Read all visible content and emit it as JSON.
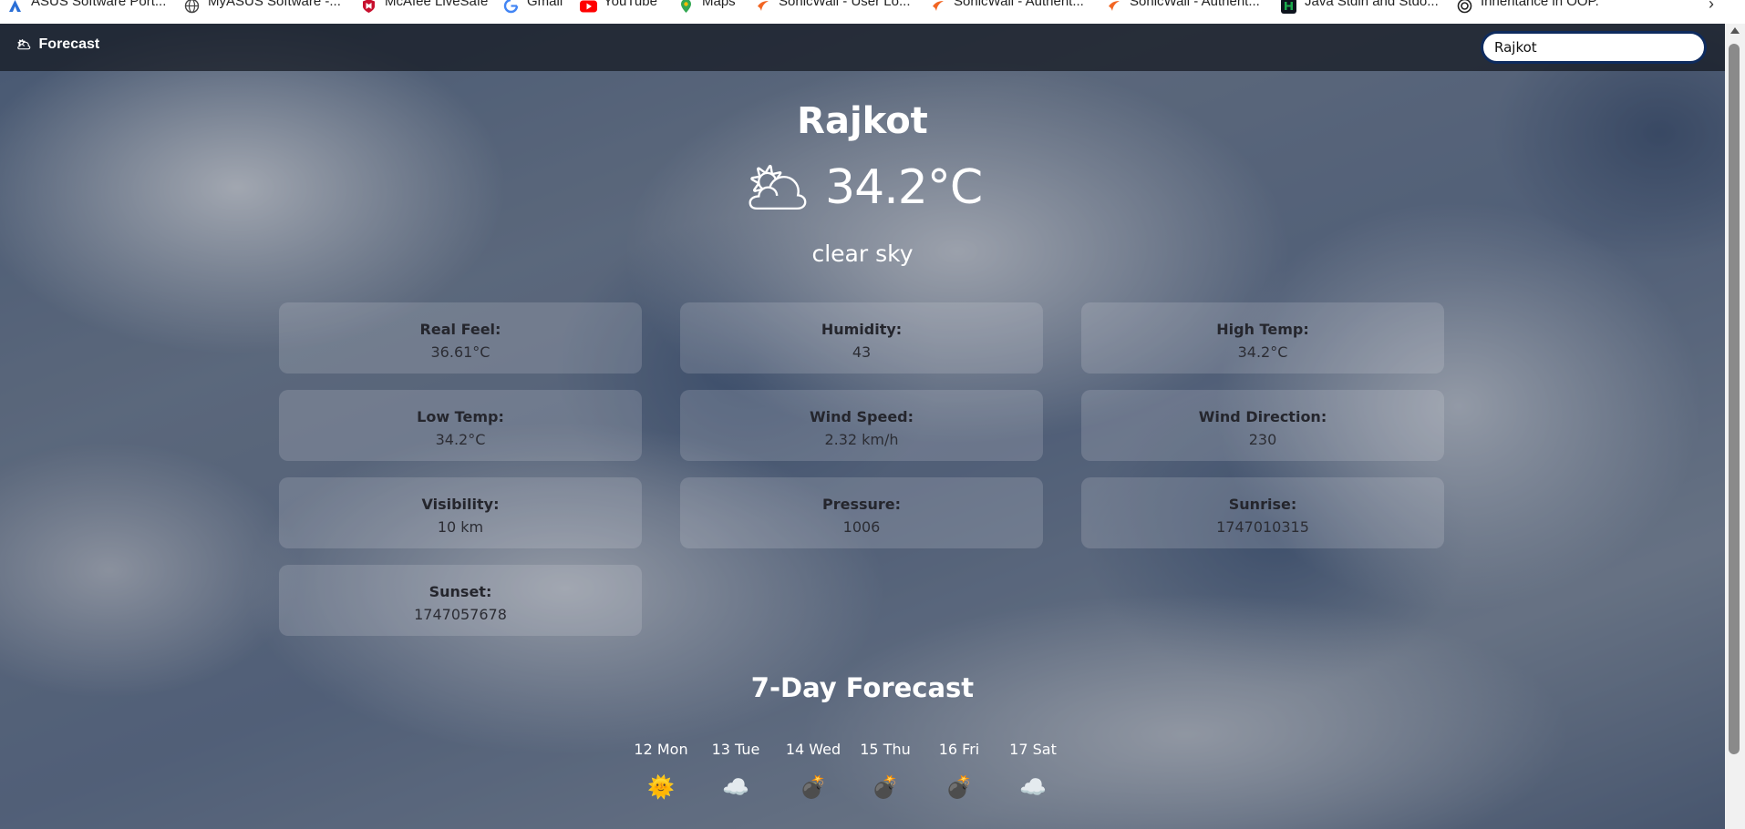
{
  "bookmarks": [
    {
      "label": "ASUS Software Port...",
      "icon": "asus-icon",
      "color": "#2b6fd6"
    },
    {
      "label": "MyASUS Software -...",
      "icon": "globe-icon",
      "color": "#444444"
    },
    {
      "label": "McAfee LiveSafe",
      "icon": "mcafee-shield-icon",
      "color": "#c8102e"
    },
    {
      "label": "Gmail",
      "icon": "google-g-icon",
      "color": "#4285f4"
    },
    {
      "label": "YouTube",
      "icon": "youtube-icon",
      "color": "#ff0000"
    },
    {
      "label": "Maps",
      "icon": "maps-pin-icon",
      "color": "#34a853"
    },
    {
      "label": "SonicWall - User Lo...",
      "icon": "sonicwall-icon",
      "color": "#f26522"
    },
    {
      "label": "SonicWall - Authent...",
      "icon": "sonicwall-icon",
      "color": "#f26522"
    },
    {
      "label": "SonicWall - Authent...",
      "icon": "sonicwall-icon",
      "color": "#f26522"
    },
    {
      "label": "Java Stdin and Stdo...",
      "icon": "hackerrank-icon",
      "color": "#1ba94c"
    },
    {
      "label": "Inheritance in OOP.",
      "icon": "openai-icon",
      "color": "#222222"
    }
  ],
  "navbar": {
    "brand": "Forecast",
    "brand_icon": "🌥",
    "search_value": "Rajkot"
  },
  "weather": {
    "city": "Rajkot",
    "icon": "🌥",
    "temp": "34.2°C",
    "description": "clear sky"
  },
  "details": [
    {
      "label": "Real Feel:",
      "value": "36.61°C"
    },
    {
      "label": "Humidity:",
      "value": "43"
    },
    {
      "label": "High Temp:",
      "value": "34.2°C"
    },
    {
      "label": "Low Temp:",
      "value": "34.2°C"
    },
    {
      "label": "Wind Speed:",
      "value": "2.32 km/h"
    },
    {
      "label": "Wind Direction:",
      "value": "230"
    },
    {
      "label": "Visibility:",
      "value": "10 km"
    },
    {
      "label": "Pressure:",
      "value": "1006"
    },
    {
      "label": "Sunrise:",
      "value": "1747010315"
    },
    {
      "label": "Sunset:",
      "value": "1747057678"
    }
  ],
  "forecast": {
    "title": "7-Day Forecast",
    "days": [
      {
        "label": "12 Mon",
        "icon": "🌞",
        "icon_name": "sun-icon"
      },
      {
        "label": "13 Tue",
        "icon": "☁️",
        "icon_name": "cloud-icon"
      },
      {
        "label": "14 Wed",
        "icon": "💣",
        "icon_name": "bomb-icon"
      },
      {
        "label": "15 Thu",
        "icon": "💣",
        "icon_name": "bomb-icon"
      },
      {
        "label": "16 Fri",
        "icon": "💣",
        "icon_name": "bomb-icon"
      },
      {
        "label": "17 Sat",
        "icon": "☁️",
        "icon_name": "cloud-icon"
      }
    ]
  }
}
